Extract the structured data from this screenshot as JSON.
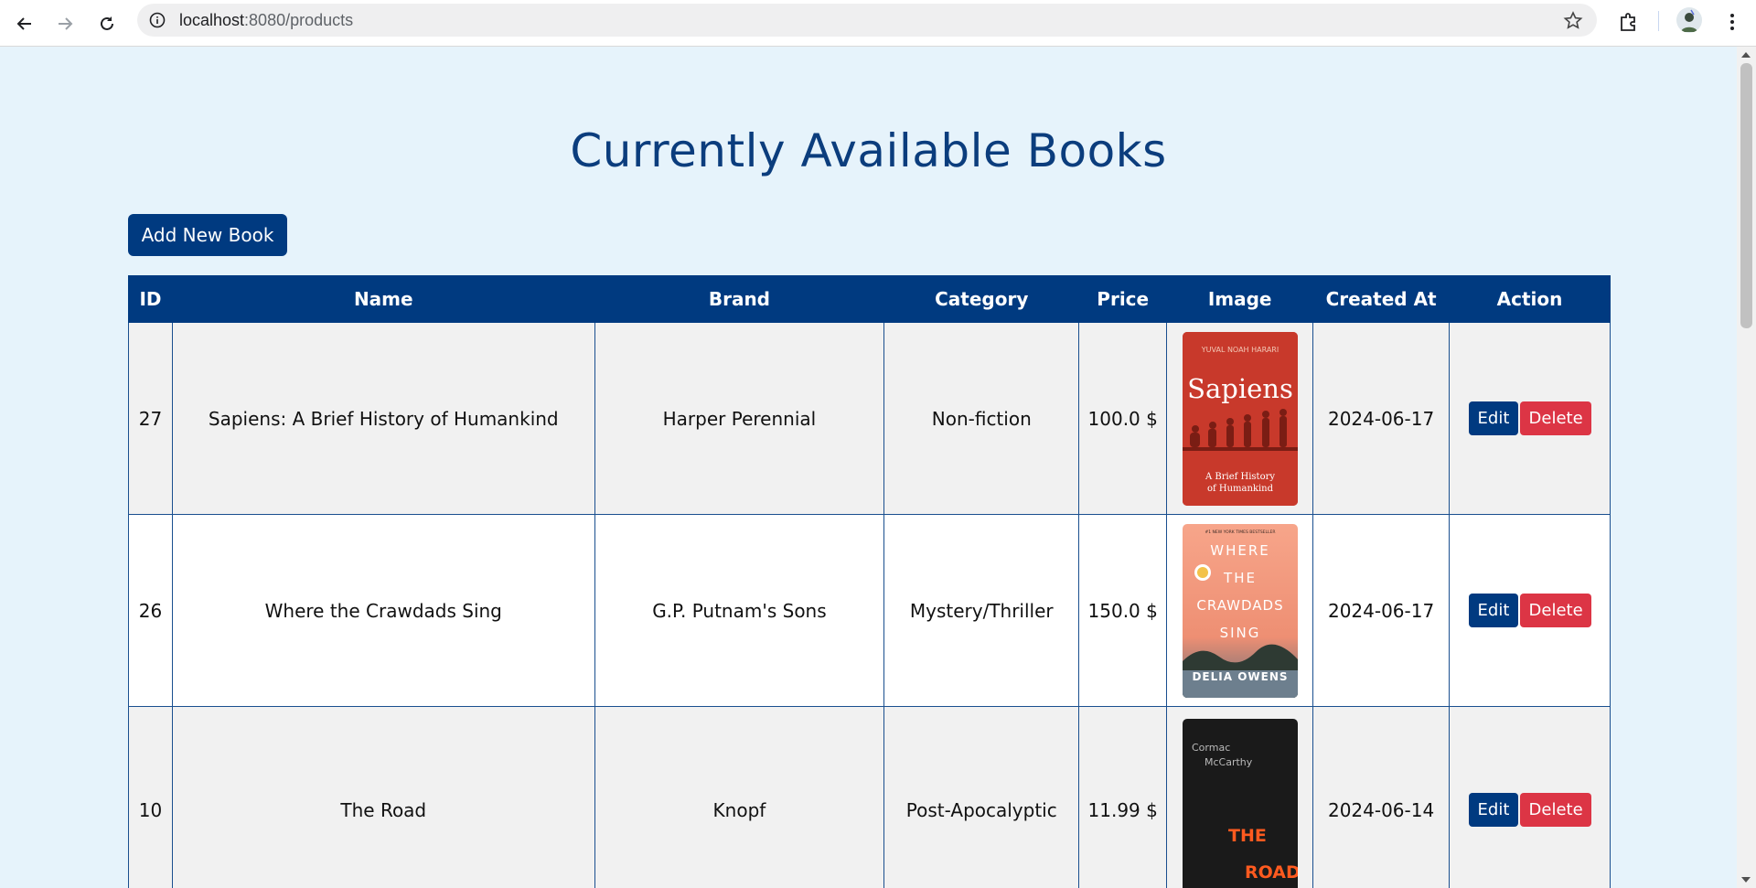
{
  "browser": {
    "url_host": "localhost",
    "url_rest": ":8080/products",
    "icons": [
      "back-arrow-icon",
      "forward-arrow-icon",
      "reload-icon",
      "site-info-icon",
      "star-icon",
      "extensions-icon",
      "avatar",
      "kebab-menu-icon"
    ]
  },
  "page": {
    "title": "Currently Available Books",
    "add_button": "Add New Book"
  },
  "table": {
    "headers": [
      "ID",
      "Name",
      "Brand",
      "Category",
      "Price",
      "Image",
      "Created At",
      "Action"
    ],
    "rows": [
      {
        "id": "27",
        "name": "Sapiens: A Brief History of Humankind",
        "brand": "Harper Perennial",
        "category": "Non-fiction",
        "price": "100.0 $",
        "created": "2024-06-17",
        "cover": {
          "author": "YUVAL NOAH HARARI",
          "title": "Sapiens",
          "subtitle": "A Brief History of Humankind",
          "color": "#c8392b"
        }
      },
      {
        "id": "26",
        "name": "Where the Crawdads Sing",
        "brand": "G.P. Putnam's Sons",
        "category": "Mystery/Thriller",
        "price": "150.0 $",
        "created": "2024-06-17",
        "cover": {
          "top": "#1 NEW YORK TIMES BESTSELLER",
          "title_lines": [
            "WHERE",
            "THE",
            "CRAWDADS",
            "SING"
          ],
          "author": "DELIA OWENS",
          "color": "#f29c7c"
        }
      },
      {
        "id": "10",
        "name": "The Road",
        "brand": "Knopf",
        "category": "Post-Apocalyptic",
        "price": "11.99 $",
        "created": "2024-06-14",
        "cover": {
          "author_lines": [
            "Cormac",
            "McCarthy"
          ],
          "title_lines": [
            "THE",
            "ROAD"
          ],
          "color": "#1a1a1a"
        }
      }
    ],
    "edit_label": "Edit",
    "delete_label": "Delete"
  },
  "colors": {
    "primary": "#003a80",
    "danger": "#dc3545",
    "background": "#e6f3fb",
    "title": "#0b3d7d"
  }
}
